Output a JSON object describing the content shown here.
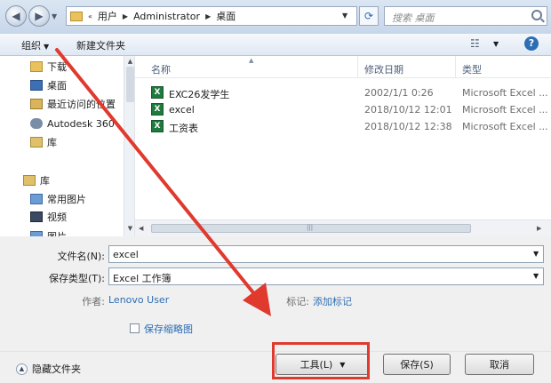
{
  "address": {
    "path": [
      "用户",
      "Administrator",
      "桌面"
    ],
    "search_placeholder": "搜索 桌面"
  },
  "toolbar": {
    "organize_label": "组织",
    "newfolder_label": "新建文件夹"
  },
  "nav": {
    "items": [
      "下载",
      "桌面",
      "最近访问的位置",
      "Autodesk 360",
      "库"
    ],
    "library_group": "库",
    "library_items": [
      "常用图片",
      "视频",
      "图片"
    ]
  },
  "list": {
    "columns": [
      "名称",
      "修改日期",
      "类型"
    ],
    "files": [
      {
        "name": "EXC26发学生",
        "date": "2002/1/1 0:26",
        "type": "Microsoft Excel ..."
      },
      {
        "name": "excel",
        "date": "2018/10/12 12:01",
        "type": "Microsoft Excel ..."
      },
      {
        "name": "工资表",
        "date": "2018/10/12 12:38",
        "type": "Microsoft Excel ..."
      }
    ]
  },
  "form": {
    "filename_label": "文件名(N):",
    "filename_value": "excel",
    "savetype_label": "保存类型(T):",
    "savetype_value": "Excel 工作簿",
    "author_label": "作者:",
    "author_value": "Lenovo User",
    "tags_label": "标记:",
    "tags_value": "添加标记",
    "thumbnail_label": "保存缩略图"
  },
  "footer": {
    "hide_folders_label": "隐藏文件夹",
    "tools_label": "工具(L)",
    "save_label": "保存(S)",
    "cancel_label": "取消"
  },
  "colors": {
    "annotation": "#e03a2f",
    "link": "#2e6db3"
  }
}
